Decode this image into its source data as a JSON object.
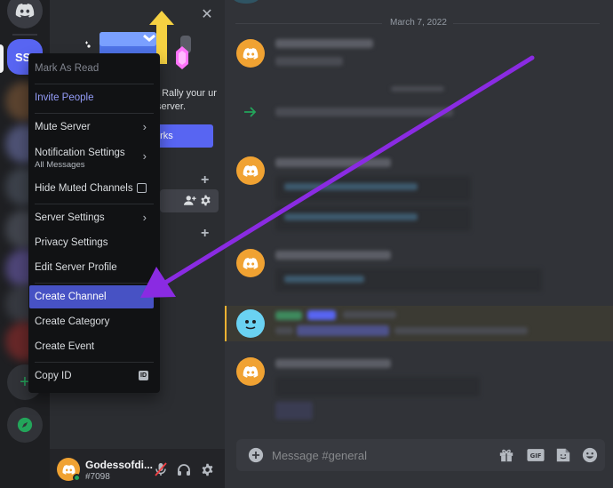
{
  "server_rail": {
    "server_initials": "SS"
  },
  "banner": {
    "promo_text": "! Rally your ur server.",
    "button_label": "erks"
  },
  "context_menu": {
    "items": [
      {
        "label": "Mark As Read",
        "state": "disabled"
      },
      {
        "label": "Invite People",
        "color": "#949cf7"
      },
      {
        "label": "Mute Server",
        "has_submenu": true
      },
      {
        "label": "Notification Settings",
        "sublabel": "All Messages",
        "has_submenu": true
      },
      {
        "label": "Hide Muted Channels",
        "has_checkbox": true,
        "checked": false
      },
      {
        "label": "Server Settings",
        "has_submenu": true
      },
      {
        "label": "Privacy Settings"
      },
      {
        "label": "Edit Server Profile"
      },
      {
        "label": "Create Channel",
        "highlighted": true
      },
      {
        "label": "Create Category"
      },
      {
        "label": "Create Event"
      },
      {
        "label": "Copy ID",
        "badge": "ID"
      }
    ]
  },
  "chat": {
    "date_separator": "March 7, 2022",
    "composer_placeholder": "Message #general"
  },
  "user_panel": {
    "username": "Godessofdi...",
    "discriminator": "#7098"
  },
  "colors": {
    "accent": "#5865f2",
    "menu_highlight": "#4752c4",
    "arrow": "#8a2be2",
    "avatar_orange": "#f0a232",
    "online": "#23a55a"
  },
  "icons": {
    "rail": [
      "discord-logo-icon",
      "add-server-icon",
      "explore-compass-icon"
    ],
    "user_controls": [
      "mic-muted-icon",
      "headphones-icon",
      "settings-gear-icon"
    ],
    "composer": [
      "add-attachment-icon",
      "gift-icon",
      "gif-icon",
      "sticker-icon",
      "emoji-icon"
    ]
  }
}
